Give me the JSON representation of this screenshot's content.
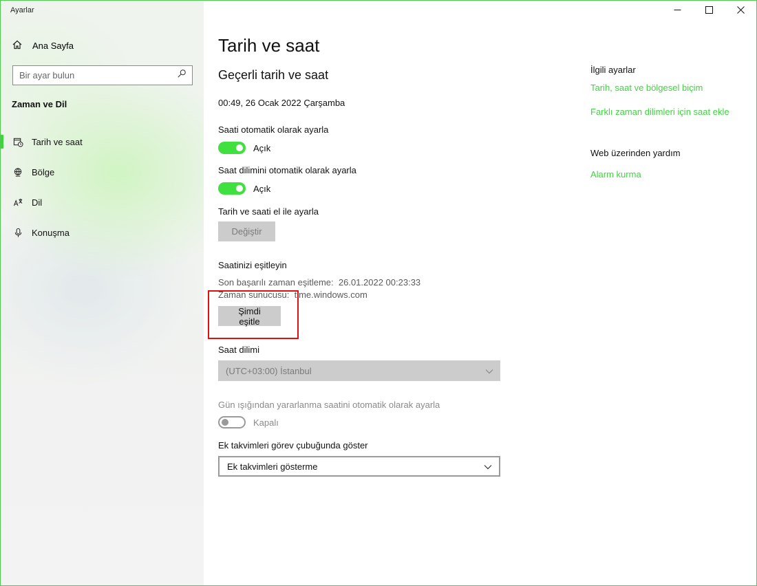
{
  "window": {
    "app_title": "Ayarlar",
    "controls": [
      "minimize-icon",
      "maximize-icon",
      "close-icon"
    ]
  },
  "sidebar": {
    "home_label": "Ana Sayfa",
    "search_placeholder": "Bir ayar bulun",
    "section_title": "Zaman ve Dil",
    "items": [
      {
        "label": "Tarih ve saat",
        "icon": "calendar-clock-icon",
        "active": true
      },
      {
        "label": "Bölge",
        "icon": "globe-icon",
        "active": false
      },
      {
        "label": "Dil",
        "icon": "language-icon",
        "active": false
      },
      {
        "label": "Konuşma",
        "icon": "microphone-icon",
        "active": false
      }
    ]
  },
  "main": {
    "page_title": "Tarih ve saat",
    "sub_title": "Geçerli tarih ve saat",
    "current_datetime": "00:49, 26 Ocak 2022 Çarşamba",
    "auto_time": {
      "label": "Saati otomatik olarak ayarla",
      "state": "Açık",
      "on": true
    },
    "auto_timezone": {
      "label": "Saat dilimini otomatik olarak ayarla",
      "state": "Açık",
      "on": true
    },
    "manual": {
      "label": "Tarih ve saati el ile ayarla",
      "button": "Değiştir"
    },
    "sync": {
      "title": "Saatinizi eşitleyin",
      "last_sync_label": "Son başarılı zaman eşitleme:",
      "last_sync_value": "26.01.2022 00:23:33",
      "server_label": "Zaman sunucusu:",
      "server_value": "time.windows.com",
      "button": "Şimdi eşitle"
    },
    "timezone": {
      "label": "Saat dilimi",
      "value": "(UTC+03:00) İstanbul"
    },
    "dst": {
      "label": "Gün ışığından yararlanma saatini otomatik olarak ayarla",
      "state": "Kapalı",
      "on": false
    },
    "calendars": {
      "label": "Ek takvimleri görev çubuğunda göster",
      "value": "Ek takvimleri gösterme"
    }
  },
  "related": {
    "heading": "İlgili ayarlar",
    "links": [
      "Tarih, saat ve bölgesel biçim",
      "Farklı zaman dilimleri için saat ekle"
    ],
    "help_heading": "Web üzerinden yardım",
    "help_links": [
      "Alarm kurma"
    ]
  },
  "colors": {
    "accent": "#3fd43f",
    "toggle_on": "#3fe03f",
    "highlight": "#e01010"
  }
}
